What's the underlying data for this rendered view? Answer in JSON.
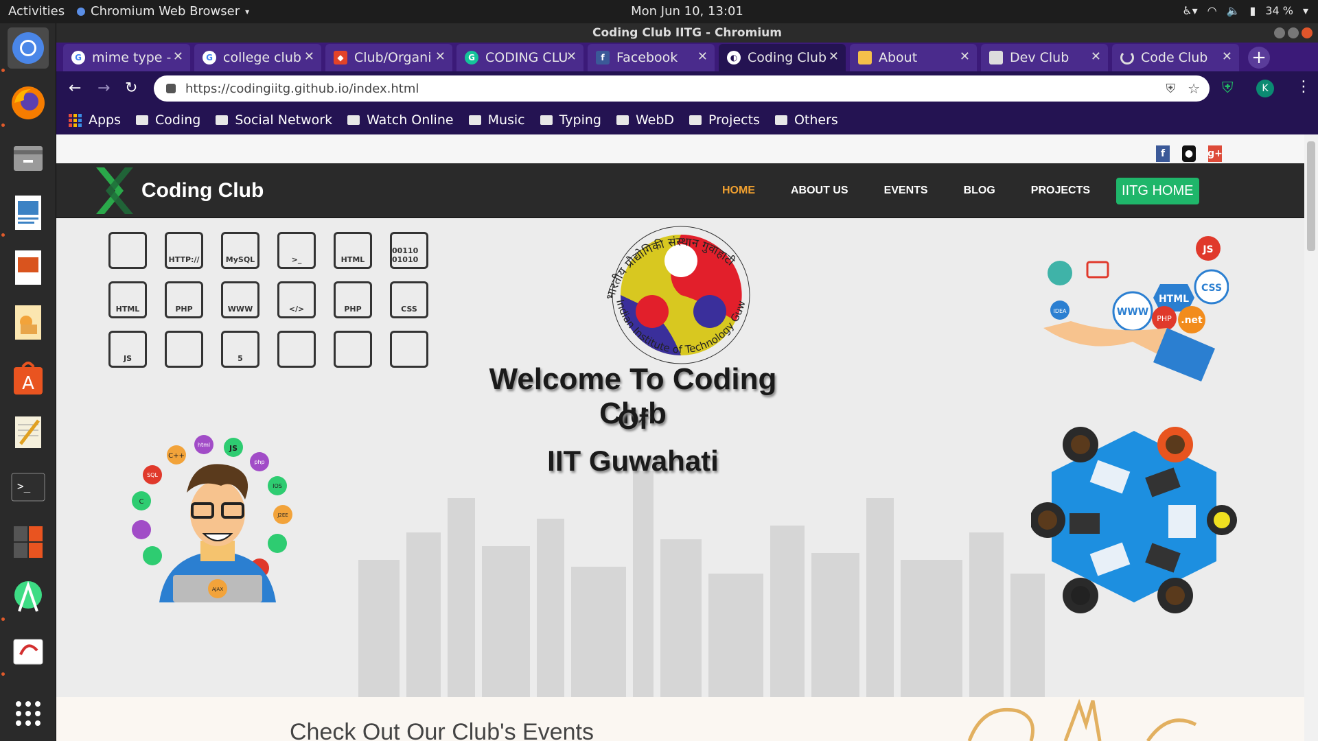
{
  "topbar": {
    "activities": "Activities",
    "app_name": "Chromium Web Browser",
    "clock": "Mon Jun 10, 13:01",
    "battery": "34 %"
  },
  "window": {
    "title": "Coding Club IITG - Chromium"
  },
  "tabs": [
    {
      "label": "mime type -",
      "favicon": "google-icon"
    },
    {
      "label": "college club",
      "favicon": "google-icon"
    },
    {
      "label": "Club/Organi",
      "favicon": "gitlab-icon"
    },
    {
      "label": "CODING CLU",
      "favicon": "grammarly-icon"
    },
    {
      "label": "Facebook",
      "favicon": "facebook-icon"
    },
    {
      "label": "Coding Club",
      "favicon": "page-icon"
    },
    {
      "label": "About",
      "favicon": "page-icon"
    },
    {
      "label": "Dev Club",
      "favicon": "page-icon"
    },
    {
      "label": "Code Club",
      "favicon": "loading-icon"
    }
  ],
  "address_bar": {
    "url": "https://codingiitg.github.io/index.html"
  },
  "profile_initial": "K",
  "bookmarks": [
    "Apps",
    "Coding",
    "Social Network",
    "Watch Online",
    "Music",
    "Typing",
    "WebD",
    "Projects",
    "Others"
  ],
  "site": {
    "social": [
      "f",
      "",
      "g+"
    ],
    "logo_text": "Coding Club",
    "menu": [
      "HOME",
      "ABOUT US",
      "EVENTS",
      "BLOG",
      "PROJECTS"
    ],
    "cta": "IITG HOME",
    "welcome_line1": "Welcome To Coding Club",
    "welcome_line2": "Of",
    "welcome_line3": "IIT Guwahati",
    "emblem_text": "भारतीय प्रौद्योगिकी संस्थान गुवाहाटी",
    "emblem_text_en": "Indian Institute of Technology Guwahati",
    "icon_labels": [
      "",
      "HTTP://",
      "MySQL",
      ">_",
      "HTML",
      "00110 01010",
      "HTML",
      "PHP",
      "WWW",
      "</>",
      "PHP",
      "CSS",
      "JS",
      "",
      "5",
      "",
      "",
      ""
    ],
    "tech_bubbles": [
      "C++",
      "html",
      "JS",
      "php",
      "SQL",
      "IOS",
      "C",
      "J2EE",
      "AJAX"
    ],
    "web_bubbles": [
      "JS",
      "CSS",
      "HTML",
      "WWW",
      "PHP",
      ".net",
      "IDEA"
    ],
    "section_heading": "Check Out Our Club's Events"
  },
  "colors": {
    "tab_bar": "#3b1a78",
    "toolbar": "#241352",
    "nav_bg": "#2a2a2a",
    "home_link": "#f0a030",
    "cta": "#1fb66a"
  }
}
